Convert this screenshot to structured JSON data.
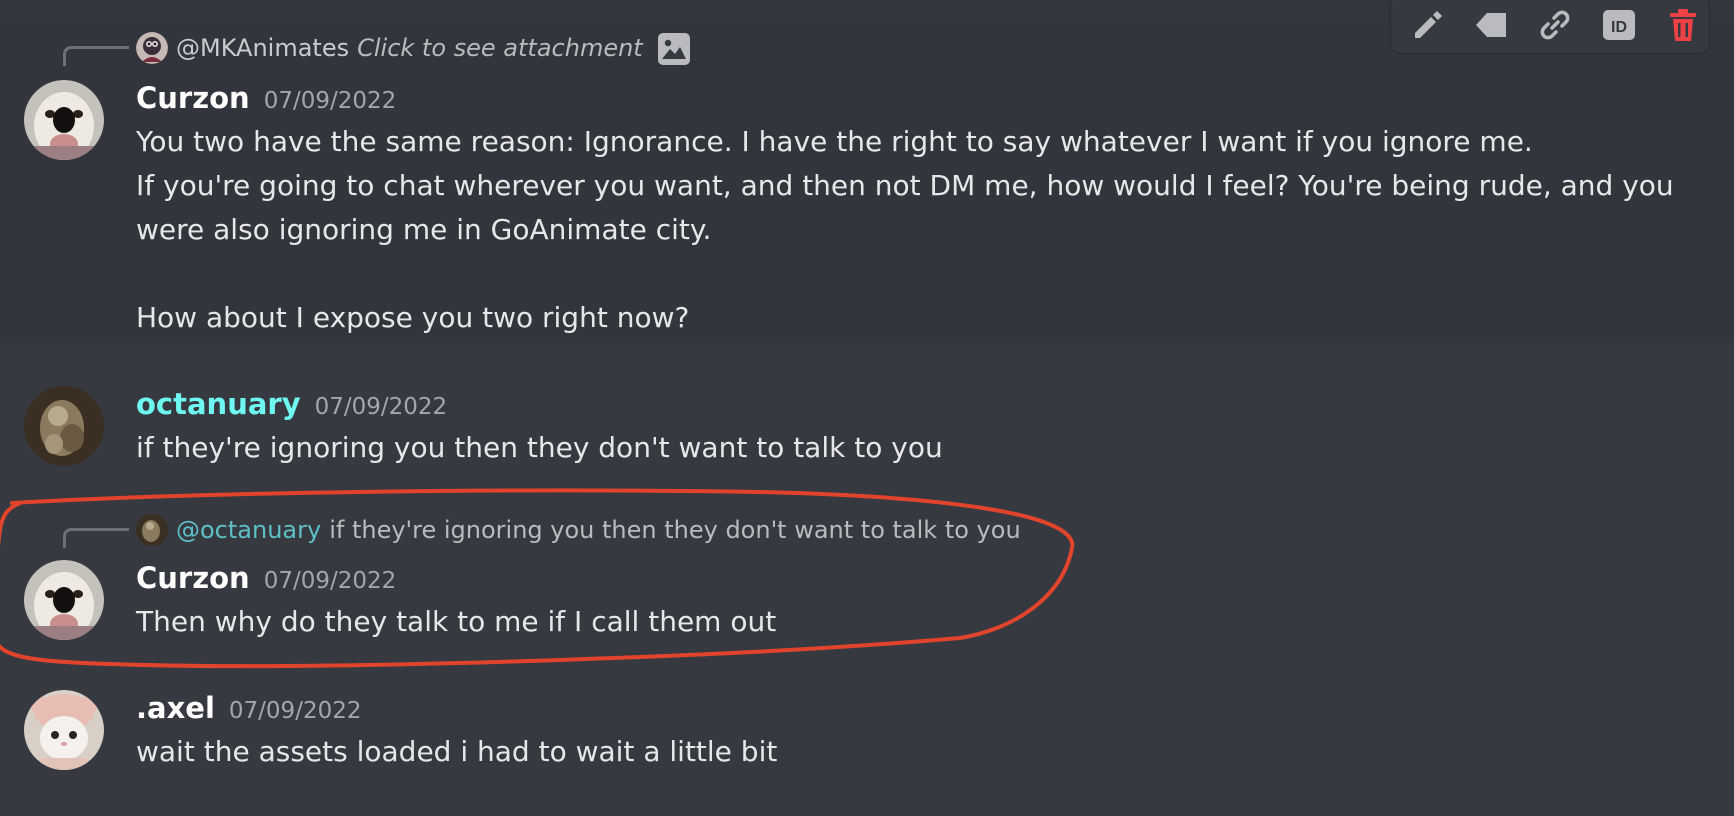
{
  "toolbar": {
    "icons": [
      "pencil-icon",
      "tag-icon",
      "link-icon",
      "id-icon",
      "trash-icon"
    ],
    "id_label": "ID",
    "danger_color": "#ed4245"
  },
  "messages": [
    {
      "reply": {
        "mention": "@MKAnimates",
        "text": "Click to see attachment",
        "icon": "image-icon"
      },
      "username": "Curzon",
      "timestamp": "07/09/2022",
      "content": "You two have the same reason: Ignorance. I have the right to say whatever I want if you ignore me.\nIf you're going to chat wherever you want, and then not DM me, how would I feel? You're being rude, and you were also ignoring me in GoAnimate city.\n\nHow about I expose you two right now?"
    },
    {
      "username": "octanuary",
      "username_color": "#6ff7f1",
      "timestamp": "07/09/2022",
      "content": "if they're ignoring you then they don't want to talk to you"
    },
    {
      "reply": {
        "mention": "@octanuary",
        "text": "if they're ignoring you then they don't want to talk to you"
      },
      "username": "Curzon",
      "timestamp": "07/09/2022",
      "content": "Then why do they talk to me if I call them out"
    },
    {
      "username": ".axel",
      "timestamp": "07/09/2022",
      "content": "wait the assets loaded i had to wait a little bit"
    }
  ],
  "colors": {
    "background": "#36393f",
    "annotation": "#e0442c",
    "mention_teal": "#5ec0c7"
  }
}
